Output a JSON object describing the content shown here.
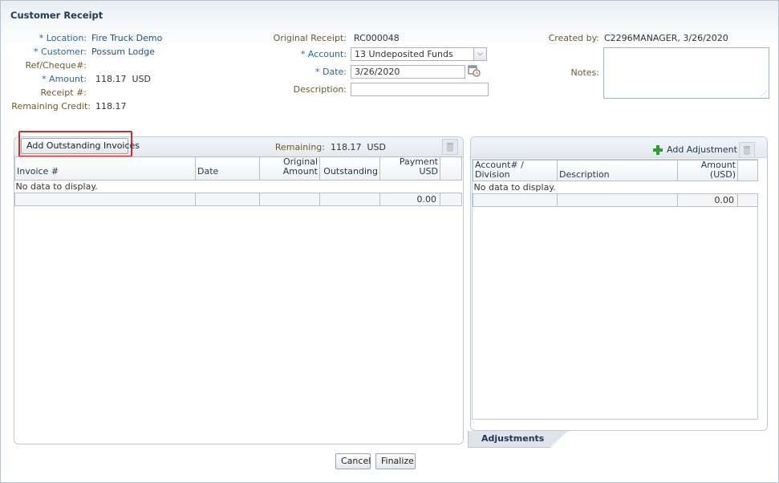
{
  "page": {
    "title": "Customer Receipt"
  },
  "left_fields": {
    "location_label": "* Location:",
    "location_value": "Fire Truck Demo",
    "customer_label": "* Customer:",
    "customer_value": "Possum Lodge",
    "ref_label": "Ref/Cheque#:",
    "amount_label": "* Amount:",
    "amount_value": "118.17  USD",
    "receipt_label": "Receipt #:",
    "remaining_label": "Remaining Credit:",
    "remaining_value": "118.17"
  },
  "middle_fields": {
    "original_receipt_label": "Original Receipt:",
    "original_receipt_value": "RC000048",
    "account_label": "* Account:",
    "account_value": "13 Undeposited Funds",
    "date_label": "* Date:",
    "date_value": "3/26/2020",
    "description_label": "Description:",
    "description_value": ""
  },
  "right_fields": {
    "created_by_label": "Created by:",
    "created_by_value": "C2296MANAGER, 3/26/2020",
    "notes_label": "Notes:",
    "notes_value": ""
  },
  "invoices_panel": {
    "add_button": "Add Outstanding Invoices",
    "remaining_label": "Remaining:",
    "remaining_value": "118.17  USD",
    "columns": [
      "Invoice #",
      "Date",
      "Original Amount",
      "Outstanding",
      "Payment USD"
    ],
    "no_data": "No data to display.",
    "payment_total": "0.00"
  },
  "adjustments_panel": {
    "add_button": "Add Adjustment",
    "columns": [
      "Account# / Division",
      "Description",
      "Amount (USD)"
    ],
    "no_data": "No data to display.",
    "amount_total": "0.00",
    "tab_label": "Adjustments"
  },
  "footer": {
    "cancel": "Cancel",
    "finalize": "Finalize"
  },
  "colors": {
    "label": "#6a5a2a",
    "link": "#1a4f8a",
    "highlight": "#d42a2a"
  },
  "icons": [
    "calendar-icon",
    "trash-icon",
    "plus-icon",
    "dropdown-arrow-icon",
    "resize-grip-icon"
  ]
}
